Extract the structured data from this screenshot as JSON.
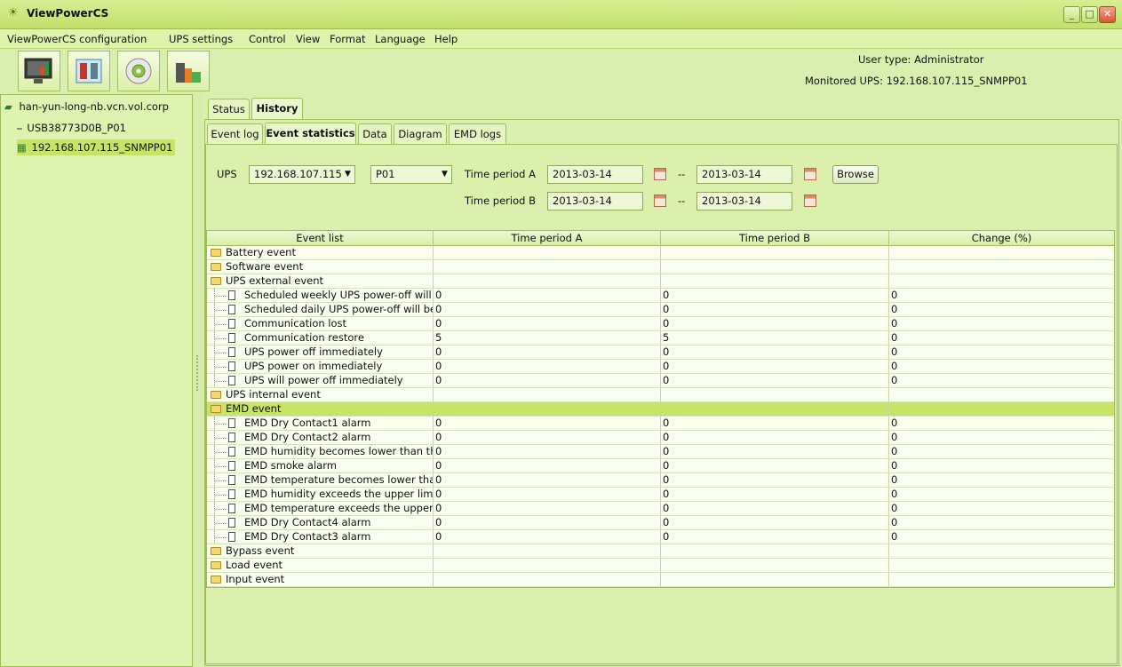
{
  "window": {
    "title": "ViewPowerCS",
    "min": "_",
    "max": "□",
    "close": "✕"
  },
  "menu": [
    "ViewPowerCS configuration",
    "UPS settings",
    "Control",
    "View",
    "Format",
    "Language",
    "Help"
  ],
  "toolbar": {
    "icons": [
      "monitor-icon",
      "config-tools-icon",
      "gear-disc-icon",
      "buildings-icon"
    ]
  },
  "info": {
    "user_type_label": "User type:",
    "user_type_value": "Administrator",
    "monitored_label": "Monitored UPS:",
    "monitored_value": "192.168.107.115_SNMPP01"
  },
  "tree": {
    "root": "han-yun-long-nb.vcn.vol.corp",
    "children": [
      "USB38773D0B_P01",
      "192.168.107.115_SNMPP01"
    ]
  },
  "tabs": {
    "top": [
      "Status",
      "History"
    ],
    "sub": [
      "Event log",
      "Event statistics",
      "Data",
      "Diagram",
      "EMD logs"
    ]
  },
  "filters": {
    "ups_label": "UPS",
    "ups_value": "192.168.107.115",
    "port_value": "P01",
    "period_a_label": "Time period A",
    "period_b_label": "Time period B",
    "a_from": "2013-03-14",
    "a_to": "2013-03-14",
    "b_from": "2013-03-14",
    "b_to": "2013-03-14",
    "sep": "--",
    "browse_label": "Browse"
  },
  "table": {
    "columns": [
      "Event list",
      "Time period A",
      "Time period B",
      "Change (%)"
    ],
    "rows": [
      {
        "type": "group",
        "label": "Battery event",
        "a": "",
        "b": "",
        "c": ""
      },
      {
        "type": "group",
        "label": "Software event",
        "a": "",
        "b": "",
        "c": ""
      },
      {
        "type": "group",
        "label": "UPS external event",
        "a": "",
        "b": "",
        "c": ""
      },
      {
        "type": "item",
        "label": "Scheduled weekly UPS power-off will b",
        "a": "0",
        "b": "0",
        "c": "0"
      },
      {
        "type": "item",
        "label": "Scheduled daily UPS power-off will be (",
        "a": "0",
        "b": "0",
        "c": "0"
      },
      {
        "type": "item",
        "label": "Communication lost",
        "a": "0",
        "b": "0",
        "c": "0"
      },
      {
        "type": "item",
        "label": "Communication restore",
        "a": "5",
        "b": "5",
        "c": "0"
      },
      {
        "type": "item",
        "label": "UPS power off immediately",
        "a": "0",
        "b": "0",
        "c": "0"
      },
      {
        "type": "item",
        "label": "UPS power on immediately",
        "a": "0",
        "b": "0",
        "c": "0"
      },
      {
        "type": "item",
        "label": "UPS will power off immediately",
        "a": "0",
        "b": "0",
        "c": "0"
      },
      {
        "type": "group",
        "label": "UPS internal event",
        "a": "",
        "b": "",
        "c": ""
      },
      {
        "type": "group",
        "label": "EMD event",
        "a": "",
        "b": "",
        "c": "",
        "selected": true
      },
      {
        "type": "item",
        "label": "EMD Dry Contact1 alarm",
        "a": "0",
        "b": "0",
        "c": "0"
      },
      {
        "type": "item",
        "label": "EMD Dry Contact2 alarm",
        "a": "0",
        "b": "0",
        "c": "0"
      },
      {
        "type": "item",
        "label": "EMD humidity becomes lower than the",
        "a": "0",
        "b": "0",
        "c": "0"
      },
      {
        "type": "item",
        "label": "EMD smoke alarm",
        "a": "0",
        "b": "0",
        "c": "0"
      },
      {
        "type": "item",
        "label": "EMD temperature becomes lower than",
        "a": "0",
        "b": "0",
        "c": "0"
      },
      {
        "type": "item",
        "label": "EMD humidity exceeds the upper limit",
        "a": "0",
        "b": "0",
        "c": "0"
      },
      {
        "type": "item",
        "label": "EMD temperature exceeds the upper lir",
        "a": "0",
        "b": "0",
        "c": "0"
      },
      {
        "type": "item",
        "label": "EMD Dry Contact4 alarm",
        "a": "0",
        "b": "0",
        "c": "0"
      },
      {
        "type": "item",
        "label": "EMD Dry Contact3 alarm",
        "a": "0",
        "b": "0",
        "c": "0"
      },
      {
        "type": "group",
        "label": "Bypass event",
        "a": "",
        "b": "",
        "c": ""
      },
      {
        "type": "group",
        "label": "Load event",
        "a": "",
        "b": "",
        "c": ""
      },
      {
        "type": "group",
        "label": "Input event",
        "a": "",
        "b": "",
        "c": ""
      }
    ]
  }
}
